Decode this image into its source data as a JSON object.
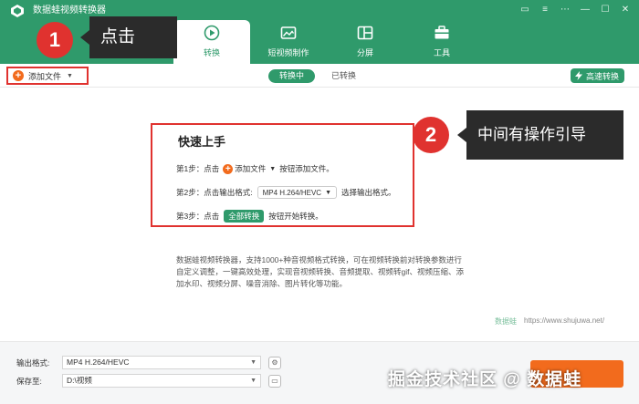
{
  "app": {
    "title": "数据蛙视频转换器"
  },
  "window_controls": [
    "comment-icon",
    "menu-icon",
    "dots-icon",
    "minimize-icon",
    "maximize-icon",
    "close-icon"
  ],
  "main_tabs": [
    {
      "label": "转换",
      "icon": "convert-icon",
      "active": true
    },
    {
      "label": "短视频制作",
      "icon": "video-maker-icon",
      "active": false
    },
    {
      "label": "分屏",
      "icon": "split-screen-icon",
      "active": false
    },
    {
      "label": "工具",
      "icon": "toolbox-icon",
      "active": false
    }
  ],
  "toolbar": {
    "add_file": "添加文件",
    "tab_converting": "转换中",
    "tab_converted": "已转换",
    "fast_convert": "高速转换"
  },
  "guide": {
    "title": "快速上手",
    "step1_prefix": "第1步：点击",
    "step1_button": "添加文件",
    "step1_suffix": "按钮添加文件。",
    "step2_prefix": "第2步：点击输出格式:",
    "step2_format": "MP4 H.264/HEVC",
    "step2_suffix": "选择输出格式。",
    "step3_prefix": "第3步：点击",
    "step3_button": "全部转换",
    "step3_suffix": "按钮开始转换。"
  },
  "description": "数据蛙视频转换器，支持1000+种音视频格式转换，可在视频转换前对转换参数进行自定义调整，一键高效处理，实现音视频转换、音频提取、视频转gif、视频压缩、添加水印、视频分屏、噪音消除、图片转化等功能。",
  "brand": {
    "name": "数据蛙",
    "url": "https://www.shujuwa.net/"
  },
  "bottom": {
    "output_format_label": "输出格式:",
    "output_format_value": "MP4 H.264/HEVC",
    "save_to_label": "保存至:",
    "save_to_value": "D:\\视频"
  },
  "annotations": [
    {
      "number": "1",
      "text": "点击"
    },
    {
      "number": "2",
      "text": "中间有操作引导"
    }
  ],
  "watermark": "掘金技术社区 @ 数据蛙",
  "colors": {
    "brand_green": "#2f9a6b",
    "accent_orange": "#f26b1d",
    "annotation_red": "#e0322f",
    "annotation_label": "#2b2b2b"
  }
}
